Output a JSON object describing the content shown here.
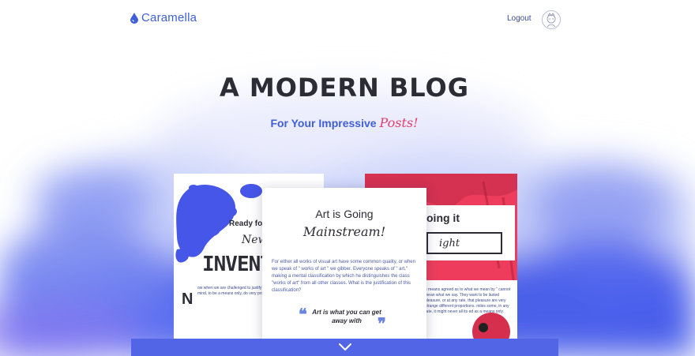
{
  "brand": {
    "name": "Caramella",
    "color": "#3f5fd8"
  },
  "nav": {
    "logout_label": "Logout",
    "avatar_icon": "avatar-icon"
  },
  "hero": {
    "title": "A MODERN BLOG",
    "subtitle": "For Your Impressive",
    "subtitle_script": "Posts!",
    "accent_color": "#e33d6c"
  },
  "cards": {
    "left": {
      "heading": "Ready fo",
      "script": "New",
      "big": "INVENTI",
      "dropcap": "N",
      "body": "ow when we are challenged to justify anything, other than a state of mind, to be a means only, do very property wh"
    },
    "center": {
      "title": "Art is Going",
      "script": "Mainstream!",
      "body": "For either all works of visual art have some common quality, or when we speak of \" works of art \" we gibber. Everyone speaks of \" art,\" making a mental classification by which he distinguishes the class \"works of art\" from all other classes. What is the justification of this classification?",
      "quote": "Art is what you can get away with",
      "quote_open": "❝",
      "quote_close": "❞"
    },
    "right": {
      "title": "oing it",
      "script": "ight",
      "body": "e means agreed as to what we mean by \" cannot mean what we say. They want to be lasted pleasure, or at any rate, that pleasure are very strange different proportions. miles some, in any rate, it might never all its ed as a means only."
    }
  },
  "scroll": {
    "icon": "chevron-down-icon"
  }
}
